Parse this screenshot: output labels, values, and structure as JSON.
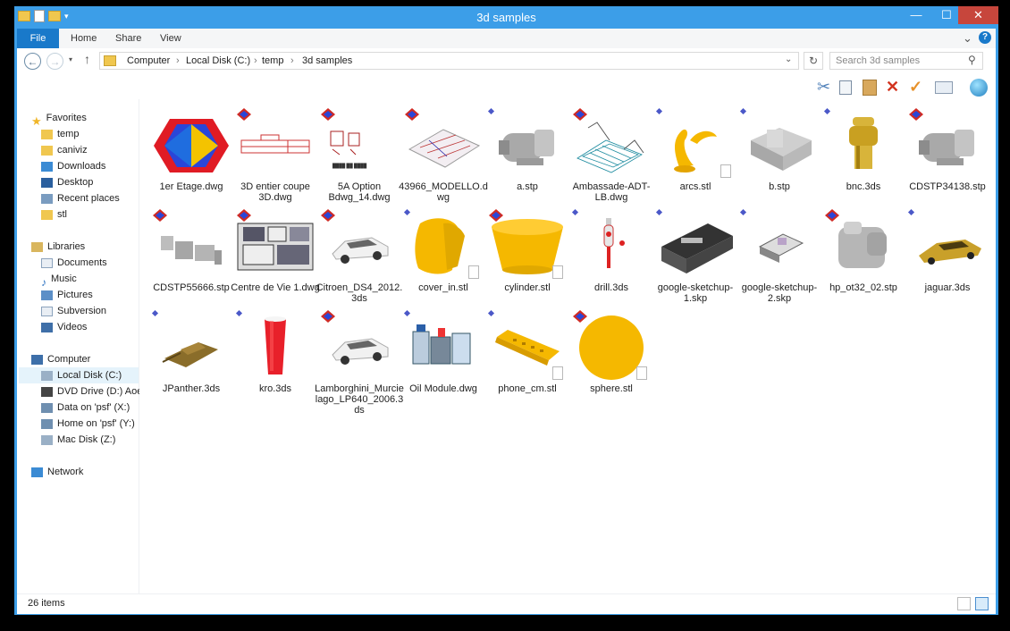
{
  "window": {
    "title": "3d samples",
    "minimize": "—",
    "maximize": "☐",
    "close": "✕"
  },
  "ribbon": {
    "tabs": [
      "File",
      "Home",
      "Share",
      "View"
    ],
    "expand": "⌄",
    "help": "?"
  },
  "address": {
    "crumbs": [
      "Computer",
      "Local Disk (C:)",
      "temp",
      "3d samples"
    ],
    "separator": "›",
    "search_placeholder": "Search 3d samples"
  },
  "sidebar": {
    "favorites": {
      "label": "Favorites",
      "items": [
        "temp",
        "caniviz",
        "Downloads",
        "Desktop",
        "Recent places",
        "stl"
      ]
    },
    "libraries": {
      "label": "Libraries",
      "items": [
        "Documents",
        "Music",
        "Pictures",
        "Subversion",
        "Videos"
      ]
    },
    "computer": {
      "label": "Computer",
      "items": [
        "Local Disk (C:)",
        "DVD Drive (D:) Aoe",
        "Data on 'psf' (X:)",
        "Home on 'psf' (Y:)",
        "Mac Disk (Z:)"
      ]
    },
    "network": {
      "label": "Network"
    }
  },
  "files": [
    {
      "name": "1er Etage.dwg",
      "thumb": "gem",
      "badge": "none"
    },
    {
      "name": "3D entier coupe 3D.dwg",
      "thumb": "redplan",
      "badge": "cube"
    },
    {
      "name": "5A Option Bdwg_14.dwg",
      "thumb": "redsketch",
      "badge": "cube"
    },
    {
      "name": "43966_MODELLO.dwg",
      "thumb": "isoplan",
      "badge": "cube"
    },
    {
      "name": "a.stp",
      "thumb": "greymotor",
      "badge": "dot"
    },
    {
      "name": "Ambassade-ADT-LB.dwg",
      "thumb": "wire",
      "badge": "cube"
    },
    {
      "name": "arcs.stl",
      "thumb": "yellowarc",
      "badge": "dot",
      "page": true
    },
    {
      "name": "b.stp",
      "thumb": "greybox",
      "badge": "dot"
    },
    {
      "name": "bnc.3ds",
      "thumb": "bnc",
      "badge": "dot"
    },
    {
      "name": "CDSTP34138.stp",
      "thumb": "greymotor",
      "badge": "cube"
    },
    {
      "name": "CDSTP55666.stp",
      "thumb": "greyparts",
      "badge": "cube"
    },
    {
      "name": "Centre de Vie 1.dwg",
      "thumb": "panel",
      "badge": "cube"
    },
    {
      "name": "Citroen_DS4_2012.3ds",
      "thumb": "whitecar",
      "badge": "cube"
    },
    {
      "name": "cover_in.stl",
      "thumb": "yellowcover",
      "badge": "dot",
      "page": true
    },
    {
      "name": "cylinder.stl",
      "thumb": "yellowcyl",
      "badge": "cube",
      "page": true
    },
    {
      "name": "drill.3ds",
      "thumb": "drill",
      "badge": "dot"
    },
    {
      "name": "google-sketchup-1.skp",
      "thumb": "machine",
      "badge": "dot"
    },
    {
      "name": "google-sketchup-2.skp",
      "thumb": "smallmachine",
      "badge": "dot"
    },
    {
      "name": "hp_ot32_02.stp",
      "thumb": "greyengine",
      "badge": "cube"
    },
    {
      "name": "jaguar.3ds",
      "thumb": "goldcar",
      "badge": "dot"
    },
    {
      "name": "JPanther.3ds",
      "thumb": "tank",
      "badge": "dot"
    },
    {
      "name": "kro.3ds",
      "thumb": "redcan",
      "badge": "dot"
    },
    {
      "name": "Lamborghini_Murcielago_LP640_2006.3ds",
      "thumb": "whitecar",
      "badge": "cube"
    },
    {
      "name": "Oil Module.dwg",
      "thumb": "oil",
      "badge": "dot"
    },
    {
      "name": "phone_cm.stl",
      "thumb": "phone",
      "badge": "dot",
      "page": true
    },
    {
      "name": "sphere.stl",
      "thumb": "sphere",
      "badge": "cube",
      "page": true
    }
  ],
  "status": {
    "items": "26 items"
  },
  "colors": {
    "titlebar": "#3c9ee8",
    "close": "#c7463c",
    "file_tab": "#1979ca",
    "yellow": "#f5b800",
    "selection": "#e5f3fb"
  }
}
